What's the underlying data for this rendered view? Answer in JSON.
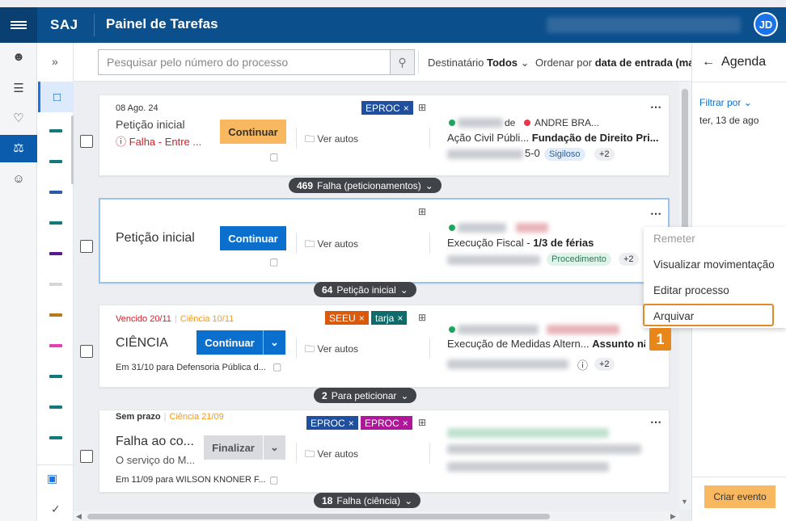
{
  "header": {
    "brand": "SAJ",
    "title": "Painel de Tarefas",
    "avatar": "JD"
  },
  "rail": {
    "icons": [
      "users-settings-icon",
      "checklist-icon",
      "handshake-icon",
      "scales-icon",
      "people-icon"
    ]
  },
  "marker_column": {
    "expand": "»"
  },
  "toolbar": {
    "search_placeholder": "Pesquisar pelo número do processo",
    "dest_label": "Destinatário",
    "dest_value": "Todos",
    "order_label": "Ordenar por",
    "order_value": "data de entrada (mais"
  },
  "cards": [
    {
      "date": "08 Ago. 24",
      "title": "Petição inicial",
      "error": "Falha - Entre ...",
      "button": "Continuar",
      "link": "Ver autos",
      "tags": [
        "EPROC"
      ],
      "right": {
        "party_right": "ANDRE BRA...",
        "line1_a": "Ação Civil Públi...",
        "line1_b": "Fundação de Direito Pri...",
        "suffix": "5-0",
        "pill": "Sigiloso",
        "count": "+2",
        "party_left_partial": "de"
      },
      "group": {
        "count": "469",
        "label": "Falha (peticionamentos)"
      }
    },
    {
      "title": "Petição inicial",
      "button": "Continuar",
      "link": "Ver autos",
      "right": {
        "line1_a": "Execução Fiscal - ",
        "line1_b": "1/3 de férias",
        "pill": "Procedimento",
        "count": "+2"
      },
      "group": {
        "count": "64",
        "label": "Petição inicial"
      }
    },
    {
      "date_a": "Vencido 20/11",
      "date_b": "Ciência 10/11",
      "title": "CIÊNCIA",
      "button": "Continuar",
      "link": "Ver autos",
      "tags": [
        "SEEU",
        "tarja"
      ],
      "footer": "Em 31/10 para Defensoria Pública d...",
      "right": {
        "line1_a": "Execução de Medidas Altern...",
        "line1_b": "Assunto nã",
        "count": "+2"
      },
      "group": {
        "count": "2",
        "label": "Para peticionar"
      }
    },
    {
      "date_a": "Sem prazo",
      "date_b": "Ciência 21/09",
      "title": "Falha ao co...",
      "subtitle": "O serviço do M...",
      "button": "Finalizar",
      "link": "Ver autos",
      "tags": [
        "EPROC",
        "EPROC"
      ],
      "footer": "Em 11/09 para WILSON KNONER F...",
      "group": {
        "count": "18",
        "label": "Falha (ciência)"
      }
    }
  ],
  "context_menu": {
    "items": [
      "Remeter",
      "Visualizar movimentação",
      "Editar processo",
      "Arquivar"
    ],
    "badge": "1"
  },
  "agenda": {
    "title": "Agenda",
    "filter": "Filtrar por",
    "date": "ter, 13 de ago",
    "create": "Criar evento"
  },
  "colors": {
    "header_bg": "#0b4f8c",
    "primary": "#0b6fce",
    "warn": "#f8b860",
    "tag_eproc": "#1f4f9e",
    "tag_seeu": "#d9590d",
    "tag_tarja": "#0f6a6a",
    "tag_eproc_magenta": "#b0169a",
    "highlight": "#e28a2a"
  }
}
